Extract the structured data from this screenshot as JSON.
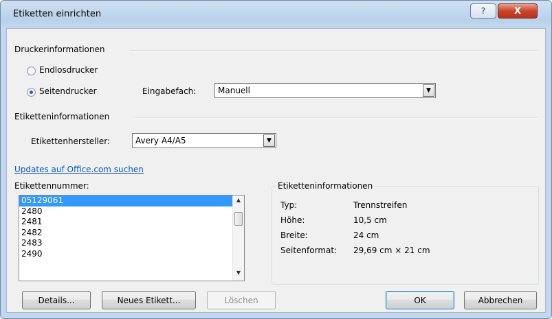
{
  "window": {
    "title": "Etiketten einrichten",
    "help_glyph": "?",
    "close_glyph": "X"
  },
  "printer_info": {
    "heading": "Druckerinformationen",
    "endless_label": "Endlosdrucker",
    "page_label": "Seitendrucker",
    "tray_label": "Eingabefach:",
    "tray_value": "Manuell"
  },
  "label_info": {
    "heading": "Etiketteninformationen",
    "vendor_label": "Etikettenhersteller:",
    "vendor_value": "Avery A4/A5"
  },
  "updates_link": "Updates auf Office.com suchen",
  "product_number": {
    "label": "Etikettennummer:",
    "items": [
      "05129061",
      "2480",
      "2481",
      "2482",
      "2483",
      "2490"
    ],
    "selected": "05129061"
  },
  "details_box": {
    "heading": "Etiketteninformationen",
    "rows": [
      {
        "key": "Typ:",
        "value": "Trennstreifen"
      },
      {
        "key": "Höhe:",
        "value": "10,5 cm"
      },
      {
        "key": "Breite:",
        "value": "24 cm"
      },
      {
        "key": "Seitenformat:",
        "value": "29,69 cm × 21 cm"
      }
    ]
  },
  "buttons": {
    "details": "Details...",
    "new_label": "Neues Etikett...",
    "delete": "Löschen",
    "ok": "OK",
    "cancel": "Abbrechen"
  },
  "icons": {
    "combo_arrow": "▼",
    "scroll_up": "▲",
    "scroll_down": "▼"
  }
}
